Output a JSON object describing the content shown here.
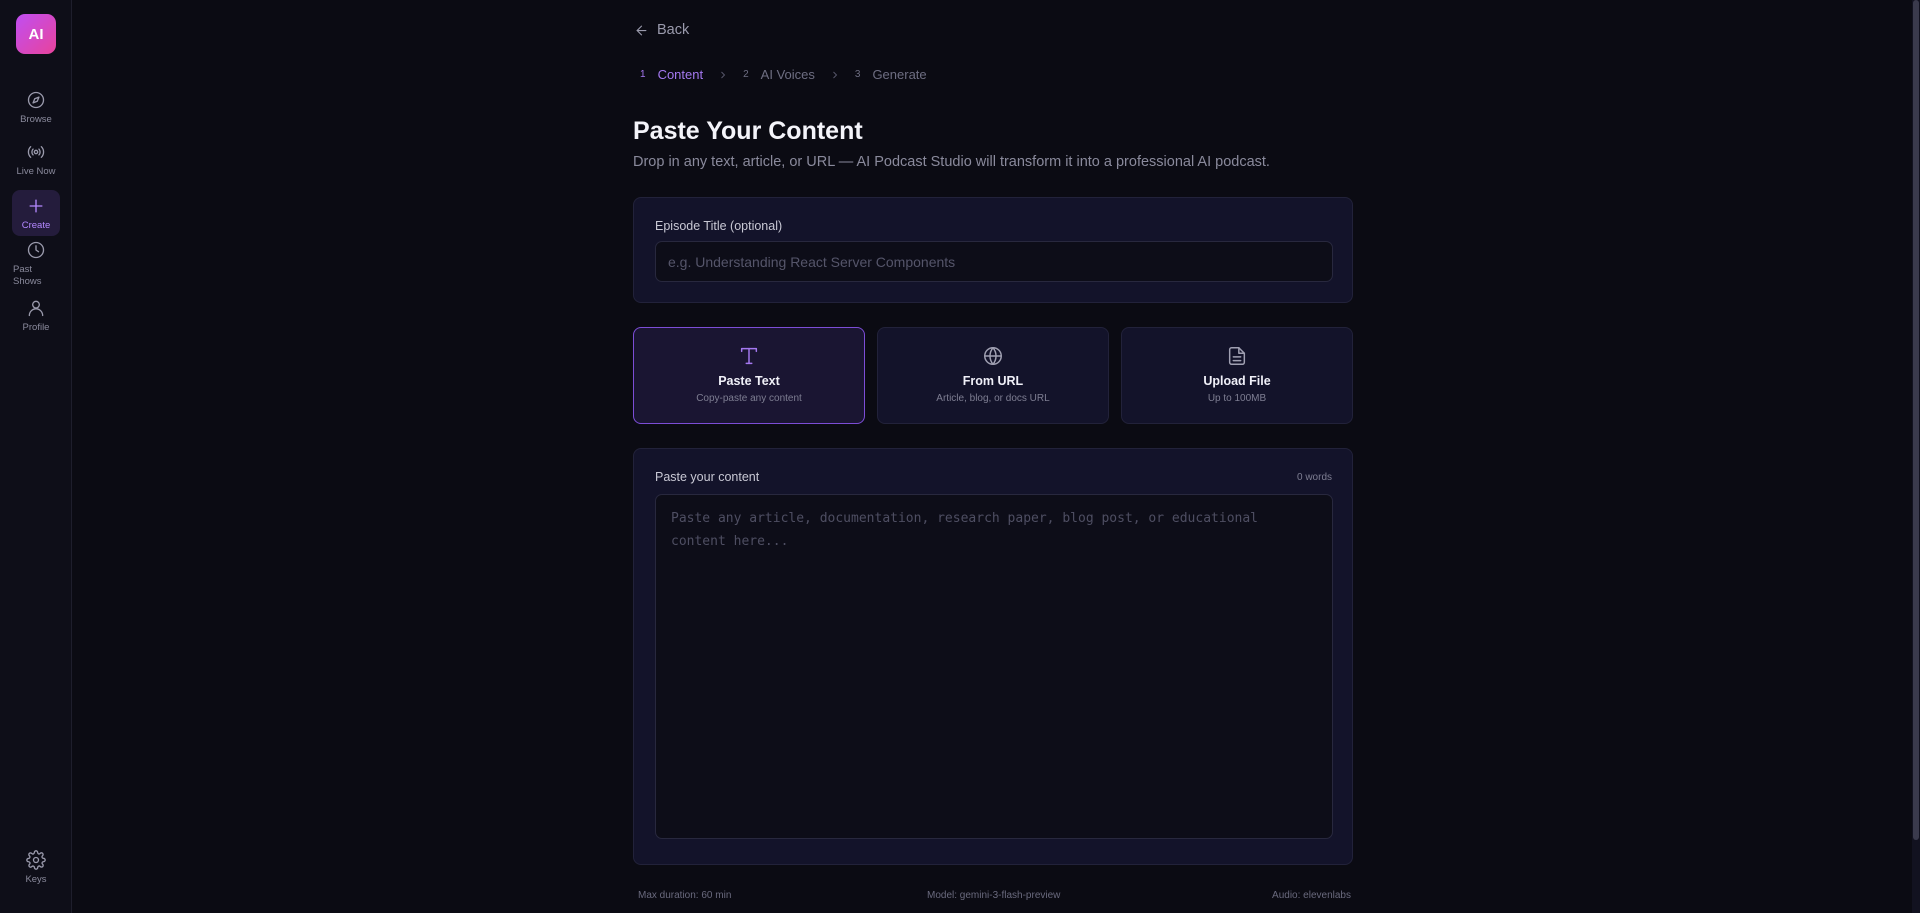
{
  "app": {
    "logo_text": "AI"
  },
  "sidebar": {
    "items": [
      {
        "label": "Browse",
        "icon": "compass-icon"
      },
      {
        "label": "Live Now",
        "icon": "broadcast-icon"
      },
      {
        "label": "Create",
        "icon": "plus-icon",
        "active": true
      },
      {
        "label": "Past Shows",
        "icon": "clock-icon"
      },
      {
        "label": "Profile",
        "icon": "user-icon"
      }
    ],
    "bottom_item": {
      "label": "Keys",
      "icon": "gear-icon"
    }
  },
  "nav": {
    "back_label": "Back"
  },
  "steps": [
    {
      "num": "1",
      "label": "Content",
      "active": true
    },
    {
      "num": "2",
      "label": "AI Voices",
      "active": false
    },
    {
      "num": "3",
      "label": "Generate",
      "active": false
    }
  ],
  "page": {
    "title": "Paste Your Content",
    "subtitle": "Drop in any text, article, or URL — AI Podcast Studio will transform it into a professional AI podcast."
  },
  "episode": {
    "label": "Episode Title (optional)",
    "value": "",
    "placeholder": "e.g. Understanding React Server Components"
  },
  "modes": [
    {
      "title": "Paste Text",
      "subtitle": "Copy-paste any content",
      "icon": "text-icon",
      "active": true
    },
    {
      "title": "From URL",
      "subtitle": "Article, blog, or docs URL",
      "icon": "globe-icon",
      "active": false
    },
    {
      "title": "Upload File",
      "subtitle": "Up to 100MB",
      "icon": "file-icon",
      "active": false
    }
  ],
  "content": {
    "label": "Paste your content",
    "word_count": "0 words",
    "value": "",
    "placeholder": "Paste any article, documentation, research paper, blog post, or educational content here..."
  },
  "footer": {
    "max_duration": "Max duration: 60 min",
    "model": "Model: gemini-3-flash-preview",
    "audio": "Audio: elevenlabs"
  },
  "colors": {
    "background": "#0b0b13",
    "accent": "#a478f0",
    "logo_gradient_start": "#c04ef2",
    "logo_gradient_end": "#e8439b"
  }
}
